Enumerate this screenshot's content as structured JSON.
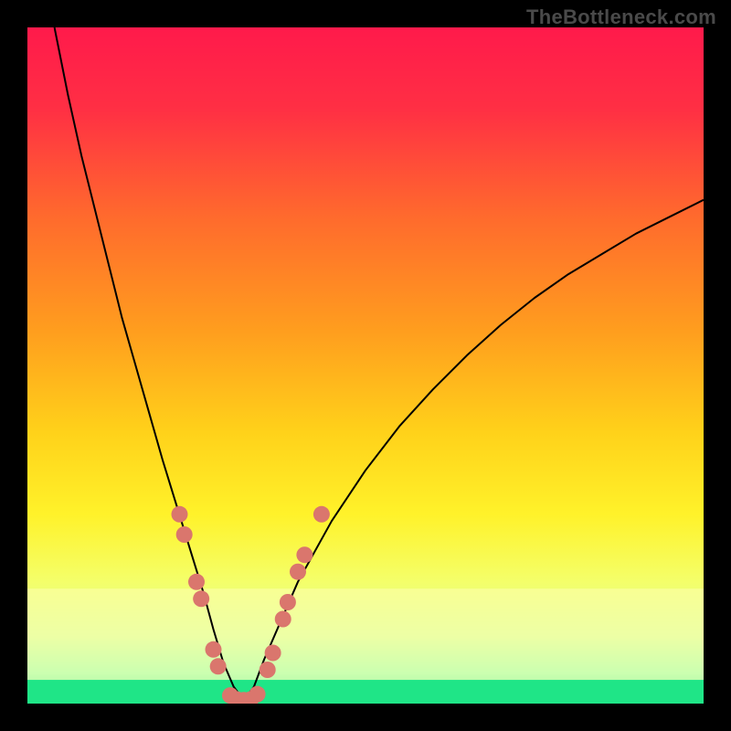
{
  "watermark": "TheBottleneck.com",
  "chart_data": {
    "type": "line",
    "title": "",
    "xlabel": "",
    "ylabel": "",
    "xlim": [
      0,
      100
    ],
    "ylim": [
      0,
      100
    ],
    "series": [
      {
        "name": "bottleneck-curve",
        "x": [
          4,
          6,
          8,
          10,
          12,
          14,
          16,
          18,
          20,
          22,
          24,
          26,
          27.5,
          29,
          30.5,
          32,
          33.5,
          35,
          40,
          45,
          50,
          55,
          60,
          65,
          70,
          75,
          80,
          85,
          90,
          95,
          100
        ],
        "y": [
          100,
          90,
          81,
          73,
          65,
          57,
          50,
          43,
          36,
          29.5,
          23,
          16.5,
          11,
          6,
          2.5,
          0.5,
          2.5,
          6.5,
          18,
          27,
          34.5,
          41,
          46.5,
          51.5,
          56,
          60,
          63.5,
          66.5,
          69.5,
          72,
          74.5
        ]
      }
    ],
    "markers": {
      "name": "highlight-dots",
      "color": "#da766d",
      "points": [
        {
          "x": 22.5,
          "y": 28
        },
        {
          "x": 23.2,
          "y": 25
        },
        {
          "x": 25.0,
          "y": 18
        },
        {
          "x": 25.7,
          "y": 15.5
        },
        {
          "x": 27.5,
          "y": 8
        },
        {
          "x": 28.2,
          "y": 5.5
        },
        {
          "x": 30.0,
          "y": 1.2
        },
        {
          "x": 31.0,
          "y": 0.6
        },
        {
          "x": 32.0,
          "y": 0.5
        },
        {
          "x": 33.0,
          "y": 0.6
        },
        {
          "x": 34.0,
          "y": 1.4
        },
        {
          "x": 35.5,
          "y": 5.0
        },
        {
          "x": 36.3,
          "y": 7.5
        },
        {
          "x": 37.8,
          "y": 12.5
        },
        {
          "x": 38.5,
          "y": 15
        },
        {
          "x": 40.0,
          "y": 19.5
        },
        {
          "x": 41.0,
          "y": 22
        },
        {
          "x": 43.5,
          "y": 28
        }
      ]
    },
    "background_gradient": {
      "stops": [
        {
          "offset": 0.0,
          "color": "#ff1a4b"
        },
        {
          "offset": 0.12,
          "color": "#ff2f44"
        },
        {
          "offset": 0.28,
          "color": "#ff6a2d"
        },
        {
          "offset": 0.45,
          "color": "#ff9e1e"
        },
        {
          "offset": 0.6,
          "color": "#ffd21a"
        },
        {
          "offset": 0.72,
          "color": "#fff22a"
        },
        {
          "offset": 0.82,
          "color": "#f4ff6a"
        },
        {
          "offset": 0.9,
          "color": "#d7ff97"
        },
        {
          "offset": 0.955,
          "color": "#8cffb0"
        },
        {
          "offset": 1.0,
          "color": "#18e084"
        }
      ]
    },
    "green_band": {
      "y0": 0,
      "y1": 3.5
    }
  }
}
